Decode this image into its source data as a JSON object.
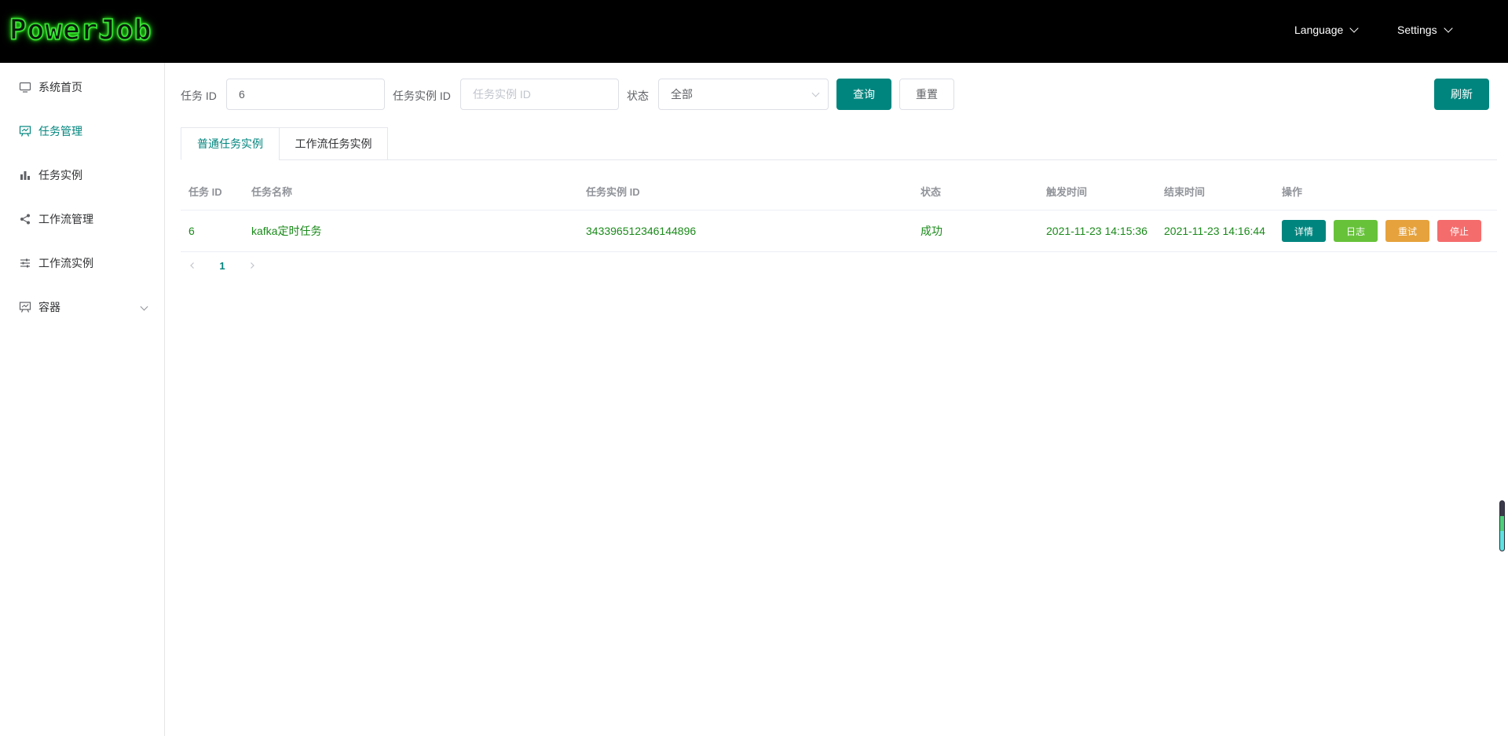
{
  "header": {
    "logo": "PowerJob",
    "language_label": "Language",
    "settings_label": "Settings"
  },
  "sidebar": {
    "items": [
      {
        "label": "系统首页",
        "icon": "monitor-icon",
        "active": false
      },
      {
        "label": "任务管理",
        "icon": "presentation-board-icon",
        "active": true
      },
      {
        "label": "任务实例",
        "icon": "bar-chart-icon",
        "active": false
      },
      {
        "label": "工作流管理",
        "icon": "share-icon",
        "active": false
      },
      {
        "label": "工作流实例",
        "icon": "sliders-icon",
        "active": false
      },
      {
        "label": "容器",
        "icon": "presentation-board-icon",
        "active": false,
        "expandable": true
      }
    ]
  },
  "filters": {
    "task_id_label": "任务 ID",
    "task_id_value": "6",
    "instance_id_label": "任务实例 ID",
    "instance_id_placeholder": "任务实例 ID",
    "status_label": "状态",
    "status_value": "全部",
    "query_label": "查询",
    "reset_label": "重置",
    "refresh_label": "刷新"
  },
  "tabs": [
    {
      "label": "普通任务实例",
      "active": true
    },
    {
      "label": "工作流任务实例",
      "active": false
    }
  ],
  "table": {
    "columns": [
      "任务 ID",
      "任务名称",
      "任务实例 ID",
      "状态",
      "触发时间",
      "结束时间",
      "操作"
    ],
    "rows": [
      {
        "task_id": "6",
        "task_name": "kafka定时任务",
        "instance_id": "343396512346144896",
        "status": "成功",
        "trigger_time": "2021-11-23 14:15:36",
        "end_time": "2021-11-23 14:16:44",
        "actions": [
          "详情",
          "日志",
          "重试",
          "停止"
        ]
      }
    ]
  },
  "pagination": {
    "current_page": "1"
  },
  "colors": {
    "primary": "#00857e",
    "success_text": "#1a8a1a",
    "detail_button": "#00857e",
    "log_button": "#67c23a",
    "retry_button": "#e6a23c",
    "stop_button": "#f56c6c"
  }
}
